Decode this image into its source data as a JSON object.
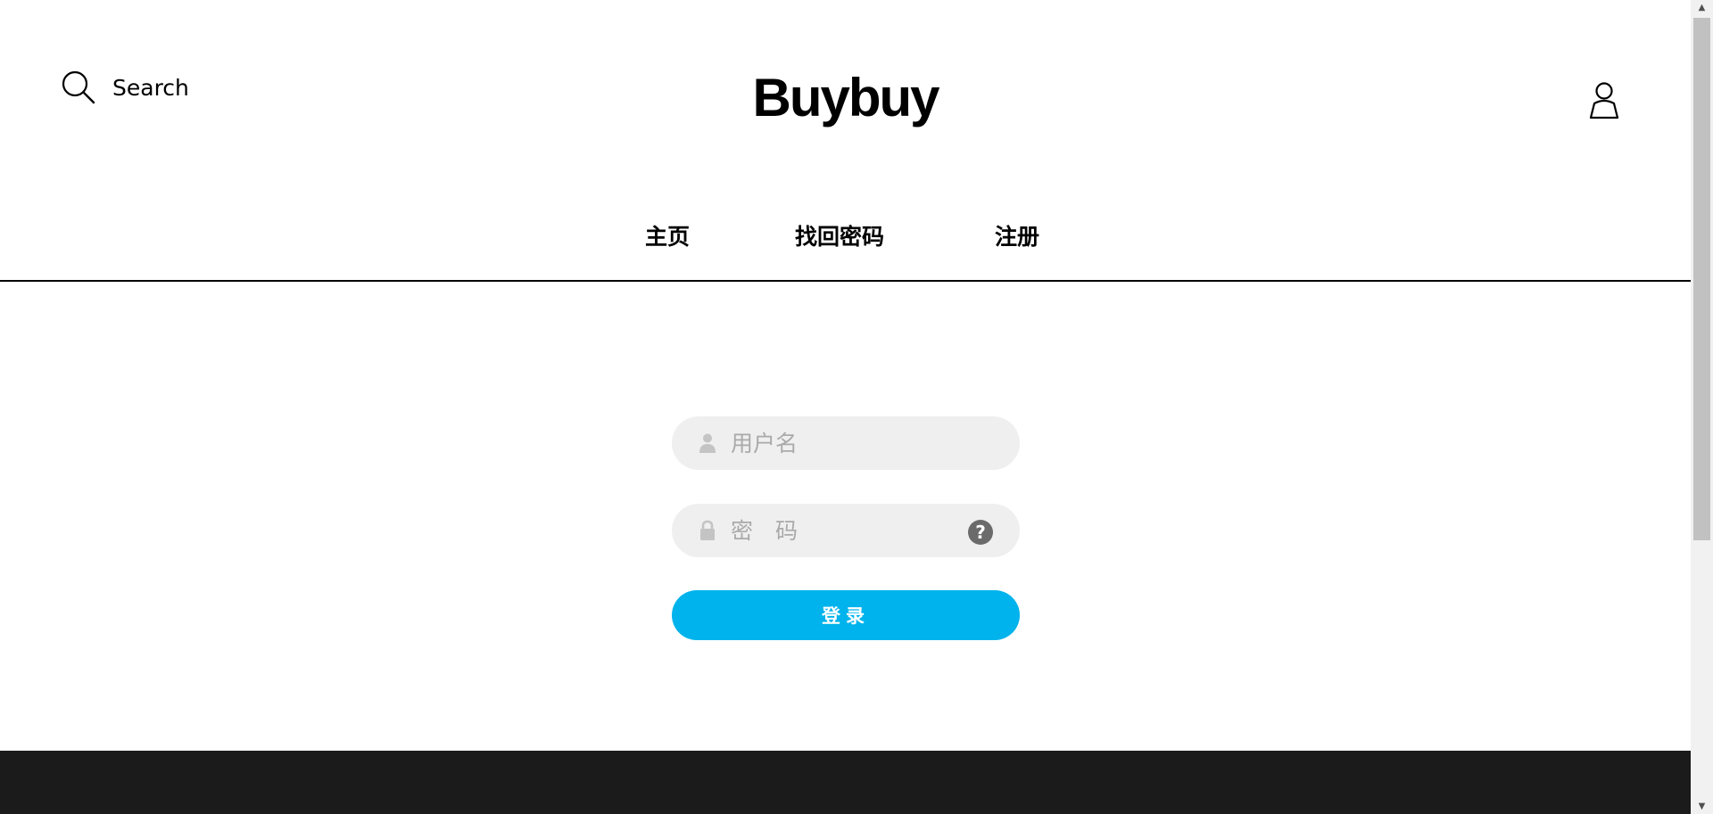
{
  "header": {
    "search_label": "Search",
    "logo": "Buybuy"
  },
  "nav": {
    "home": "主页",
    "recover_password": "找回密码",
    "register": "注册"
  },
  "login": {
    "username_placeholder": "用户名",
    "password_placeholder": "密　码",
    "help_label": "?",
    "submit_label": "登录"
  },
  "colors": {
    "top_strip": "#aef5e6",
    "button": "#00b3ec",
    "field_bg": "#efefef",
    "footer": "#1b1b1b"
  },
  "icons": {
    "search": "search-icon",
    "user": "user-icon",
    "username_field": "person-icon",
    "password_field": "lock-icon",
    "help": "question-circle-icon"
  }
}
